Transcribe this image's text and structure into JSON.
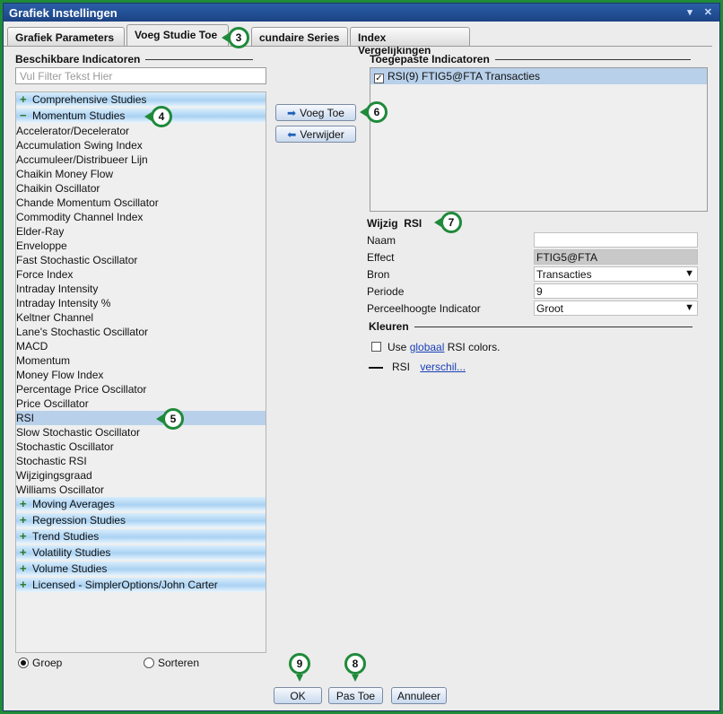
{
  "window": {
    "title": "Grafiek Instellingen",
    "min_icon": "▾",
    "close_icon": "✕"
  },
  "tabs": [
    {
      "label": "Grafiek Parameters"
    },
    {
      "label": "Voeg Studie Toe"
    },
    {
      "label": "cundaire Series"
    },
    {
      "label": "Index Vergelijkingen"
    }
  ],
  "available": {
    "heading": "Beschikbare Indicatoren",
    "filter_placeholder": "Vul Filter Tekst Hier",
    "groups_top": [
      {
        "label": "Comprehensive Studies",
        "state": "+"
      },
      {
        "label": "Momentum Studies",
        "state": "−"
      }
    ],
    "items": [
      "Accelerator/Decelerator",
      "Accumulation Swing Index",
      "Accumuleer/Distribueer Lijn",
      "Chaikin Money Flow",
      "Chaikin Oscillator",
      "Chande Momentum Oscillator",
      "Commodity Channel Index",
      "Elder-Ray",
      "Enveloppe",
      "Fast Stochastic Oscillator",
      "Force Index",
      "Intraday Intensity",
      "Intraday Intensity %",
      "Keltner Channel",
      "Lane's Stochastic Oscillator",
      "MACD",
      "Momentum",
      "Money Flow Index",
      "Percentage Price Oscillator",
      "Price Oscillator",
      "RSI",
      "Slow Stochastic Oscillator",
      "Stochastic Oscillator",
      "Stochastic RSI",
      "Wijzigingsgraad",
      "Williams Oscillator"
    ],
    "selected_item": "RSI",
    "groups_bottom": [
      {
        "label": "Moving Averages",
        "state": "+"
      },
      {
        "label": "Regression Studies",
        "state": "+"
      },
      {
        "label": "Trend Studies",
        "state": "+"
      },
      {
        "label": "Volatility Studies",
        "state": "+"
      },
      {
        "label": "Volume Studies",
        "state": "+"
      },
      {
        "label": "Licensed - SimplerOptions/John Carter",
        "state": "+"
      }
    ]
  },
  "actions": {
    "add_label": "Voeg Toe",
    "remove_label": "Verwijder"
  },
  "applied": {
    "heading": "Toegepaste Indicatoren",
    "rows": [
      {
        "label": "RSI(9) FTIG5@FTA Transacties",
        "checked": true
      }
    ]
  },
  "edit": {
    "heading": "Wijzig",
    "subject": "RSI",
    "fields": {
      "naam": {
        "label": "Naam",
        "value": ""
      },
      "effect": {
        "label": "Effect",
        "value": "FTIG5@FTA"
      },
      "bron": {
        "label": "Bron",
        "value": "Transacties"
      },
      "periode": {
        "label": "Periode",
        "value": "9"
      },
      "perceel": {
        "label": "Perceelhoogte Indicator",
        "value": "Groot"
      }
    }
  },
  "colors": {
    "heading": "Kleuren",
    "use_prefix": "Use",
    "use_link": "globaal",
    "use_suffix": "RSI colors.",
    "series_label": "RSI",
    "series_link": "verschil..."
  },
  "view_mode": {
    "group_label": "Groep",
    "sort_label": "Sorteren",
    "selected": "Groep"
  },
  "footer": {
    "ok_label": "OK",
    "apply_label": "Pas Toe",
    "cancel_label": "Annuleer"
  },
  "markers": [
    "3",
    "4",
    "5",
    "6",
    "7",
    "8",
    "9"
  ],
  "theme": {
    "accent": "#1f8a3a",
    "title_bg": "#1c4384",
    "selection": "#b8d0ea"
  }
}
